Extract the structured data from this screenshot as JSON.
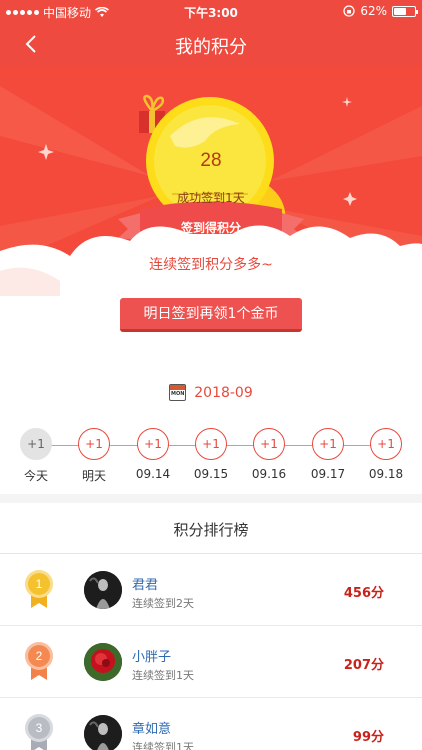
{
  "status_bar": {
    "carrier": "中国移动",
    "time": "下午3:00",
    "battery": "62%",
    "battery_level": 0.62
  },
  "nav": {
    "back_icon": "chevron-left-icon",
    "title": "我的积分"
  },
  "hero": {
    "coin_count": "28",
    "coin_subtitle": "成功签到1天",
    "ribbon_label": "签到得积分",
    "card_text": "连续签到积分多多~",
    "button_label": "明日签到再领1个金币"
  },
  "calendar": {
    "icon": "calendar-icon",
    "icon_text": "MON",
    "month": "2018-09"
  },
  "timeline": [
    {
      "value": "+1",
      "label": "今天",
      "done": true
    },
    {
      "value": "+1",
      "label": "明天",
      "done": false
    },
    {
      "value": "+1",
      "label": "09.14",
      "done": false
    },
    {
      "value": "+1",
      "label": "09.15",
      "done": false
    },
    {
      "value": "+1",
      "label": "09.16",
      "done": false
    },
    {
      "value": "+1",
      "label": "09.17",
      "done": false
    },
    {
      "value": "+1",
      "label": "09.18",
      "done": false
    }
  ],
  "ranking": {
    "title": "积分排行榜",
    "rows": [
      {
        "rank": "1",
        "medal_color": "#f5c22f",
        "ribbon_color": "#f2b01e",
        "name": "君君",
        "days": "连续签到2天",
        "points": "456分",
        "avatar": "dark"
      },
      {
        "rank": "2",
        "medal_color": "#f48a52",
        "ribbon_color": "#f2824a",
        "name": "小胖子",
        "days": "连续签到1天",
        "points": "207分",
        "avatar": "flower"
      },
      {
        "rank": "3",
        "medal_color": "#b8bcc3",
        "ribbon_color": "#a8adb5",
        "name": "章如意",
        "days": "连续签到1天",
        "points": "99分",
        "avatar": "dark"
      }
    ]
  }
}
